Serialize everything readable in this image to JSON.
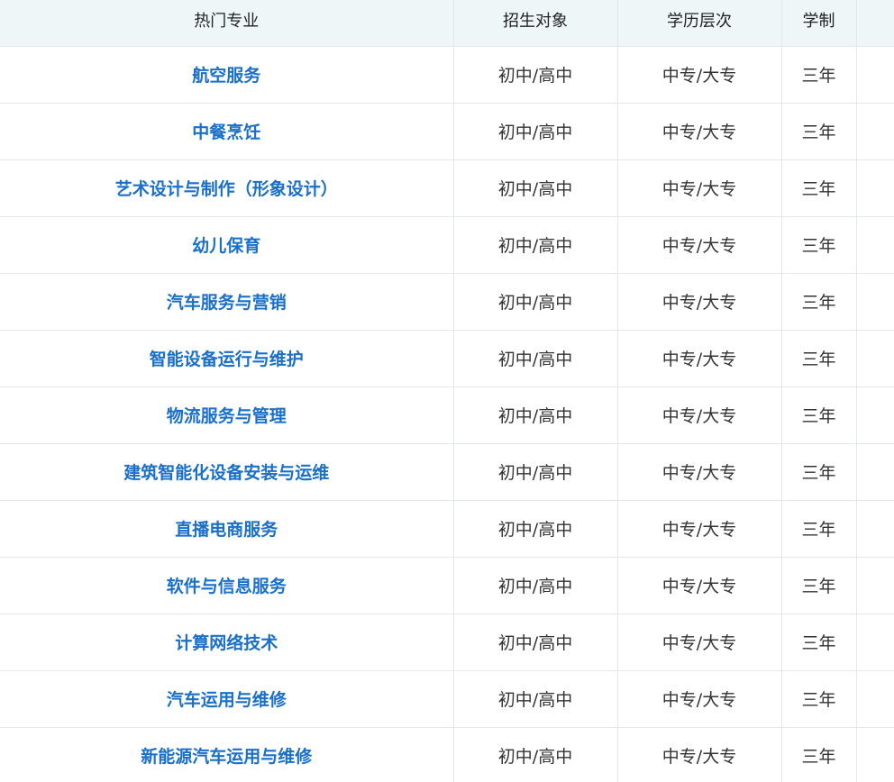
{
  "table": {
    "headers": {
      "major": "热门专业",
      "target": "招生对象",
      "level": "学历层次",
      "years": "学制"
    },
    "rows": [
      {
        "major": "航空服务",
        "target": "初中/高中",
        "level": "中专/大专",
        "years": "三年"
      },
      {
        "major": "中餐烹饪",
        "target": "初中/高中",
        "level": "中专/大专",
        "years": "三年"
      },
      {
        "major": "艺术设计与制作（形象设计）",
        "target": "初中/高中",
        "level": "中专/大专",
        "years": "三年"
      },
      {
        "major": "幼儿保育",
        "target": "初中/高中",
        "level": "中专/大专",
        "years": "三年"
      },
      {
        "major": "汽车服务与营销",
        "target": "初中/高中",
        "level": "中专/大专",
        "years": "三年"
      },
      {
        "major": "智能设备运行与维护",
        "target": "初中/高中",
        "level": "中专/大专",
        "years": "三年"
      },
      {
        "major": "物流服务与管理",
        "target": "初中/高中",
        "level": "中专/大专",
        "years": "三年"
      },
      {
        "major": "建筑智能化设备安装与运维",
        "target": "初中/高中",
        "level": "中专/大专",
        "years": "三年"
      },
      {
        "major": "直播电商服务",
        "target": "初中/高中",
        "level": "中专/大专",
        "years": "三年"
      },
      {
        "major": "软件与信息服务",
        "target": "初中/高中",
        "level": "中专/大专",
        "years": "三年"
      },
      {
        "major": "计算网络技术",
        "target": "初中/高中",
        "level": "中专/大专",
        "years": "三年"
      },
      {
        "major": "汽车运用与维修",
        "target": "初中/高中",
        "level": "中专/大专",
        "years": "三年"
      },
      {
        "major": "新能源汽车运用与维修",
        "target": "初中/高中",
        "level": "中专/大专",
        "years": "三年"
      }
    ]
  }
}
